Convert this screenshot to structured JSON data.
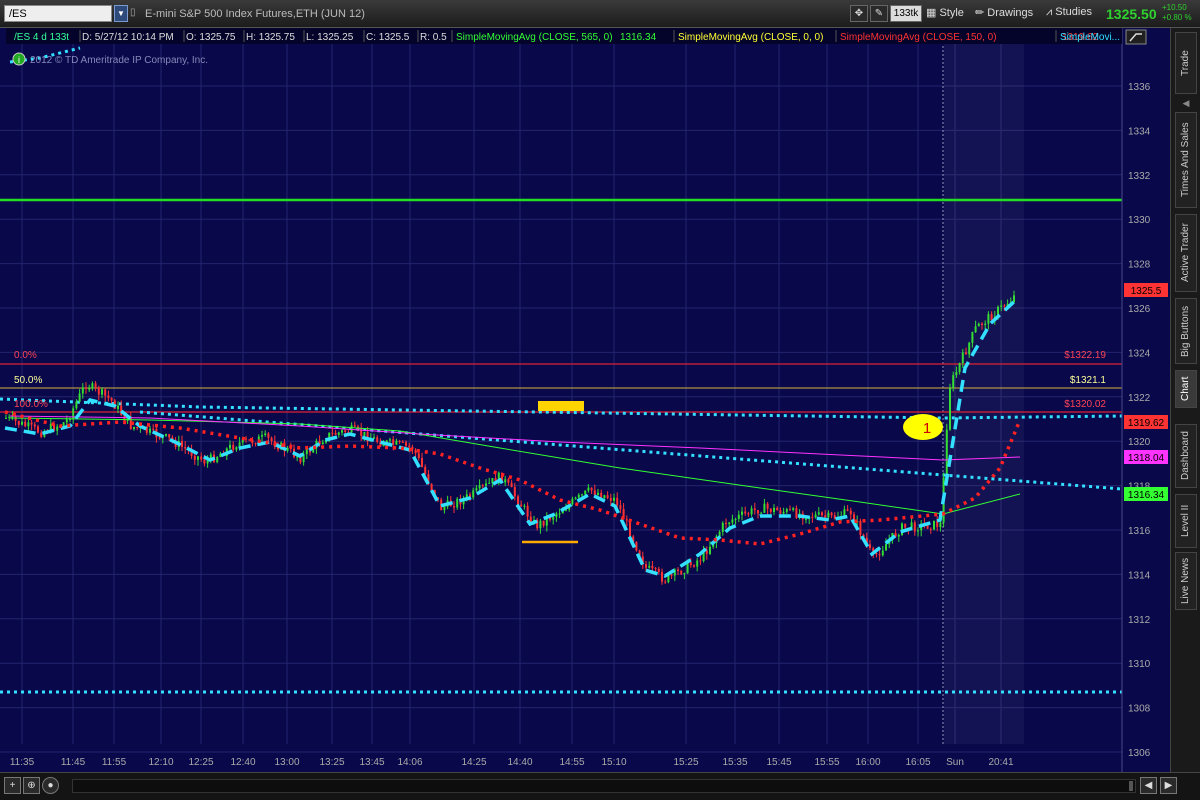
{
  "toolbar": {
    "symbol": "/ES",
    "instrument_title": "E-mini S&P 500 Index Futures,ETH (JUN 12)",
    "aggregation": "133tk",
    "style_label": "Style",
    "drawings_label": "Drawings",
    "studies_label": "Studies",
    "last_price": "1325.50",
    "change_abs": "+10.50",
    "change_pct": "+0.80 %"
  },
  "chart": {
    "header_label": "/ES 4 d 133t",
    "date_time": "D: 5/27/12 10:14 PM",
    "open": "O: 1325.75",
    "high": "H: 1325.75",
    "low": "L: 1325.25",
    "close": "C: 1325.5",
    "range": "R: 0.5",
    "studies": [
      {
        "label": "SimpleMovingAvg (CLOSE, 565, 0)",
        "value": "1316.34",
        "color": "#33ff33"
      },
      {
        "label": "SimpleMovingAvg (CLOSE, 0, 0)",
        "value": "",
        "color": "#ffff33"
      },
      {
        "label": "SimpleMovingAvg (CLOSE, 150, 0)",
        "value": "1319.62",
        "color": "#ff3333"
      },
      {
        "label": "SimpleMovi...",
        "value": "",
        "color": "#33e0ff"
      }
    ],
    "copyright": "2012 © TD Ameritrade IP Company, Inc.",
    "price_axis": [
      "1336",
      "1334",
      "1332",
      "1330",
      "1328",
      "1326",
      "1324",
      "1322",
      "1320",
      "1318",
      "1316",
      "1314",
      "1312",
      "1310",
      "1308",
      "1306"
    ],
    "time_axis": [
      "11:35",
      "11:45",
      "11:55",
      "12:10",
      "12:25",
      "12:40",
      "13:00",
      "13:25",
      "13:45",
      "14:06",
      "14:25",
      "14:40",
      "14:55",
      "15:10",
      "15:25",
      "15:35",
      "15:45",
      "15:55",
      "16:00",
      "16:05",
      "Sun",
      "20:41"
    ],
    "fib_labels": {
      "level0": "0.0%",
      "level50": "50.0%",
      "level100": "100.0%"
    },
    "fib_prices": {
      "p0": "$1322.19",
      "p50": "$1321.1",
      "p100": "$1320.02"
    },
    "price_bubbles": [
      {
        "text": "1325.5",
        "color": "#ff3333"
      },
      {
        "text": "1319.62",
        "color": "#ff3333"
      },
      {
        "text": "1318.04",
        "color": "#ff33ff"
      },
      {
        "text": "1316.34",
        "color": "#33ff33"
      }
    ],
    "trade_marker": "1",
    "colors": {
      "background": "#08084a",
      "grid": "#24246e",
      "up": "#33dd33",
      "down": "#ff3333"
    }
  },
  "right_tabs": [
    "Trade",
    "Times And Sales",
    "Active Trader",
    "Big Buttons",
    "Chart",
    "Dashboard",
    "Level II",
    "Live News"
  ],
  "active_tab": "Chart"
}
